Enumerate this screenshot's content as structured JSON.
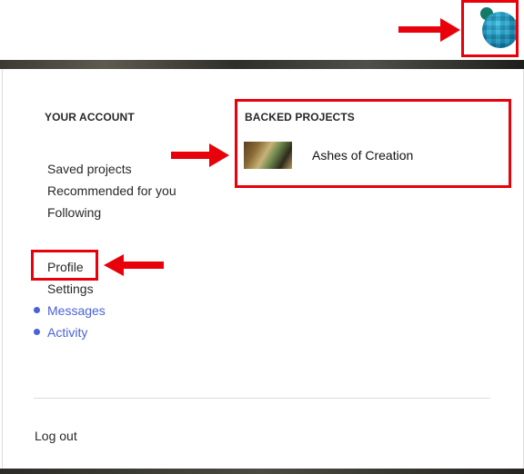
{
  "account": {
    "heading": "YOUR ACCOUNT",
    "links": [
      "Saved projects",
      "Recommended for you",
      "Following"
    ],
    "profile": "Profile",
    "settings": "Settings",
    "messages": "Messages",
    "activity": "Activity",
    "logout": "Log out"
  },
  "backed": {
    "heading": "BACKED PROJECTS",
    "project_title": "Ashes of Creation"
  },
  "colors": {
    "accent_blue": "#4a62d8",
    "annotation_red": "#e8000b"
  }
}
